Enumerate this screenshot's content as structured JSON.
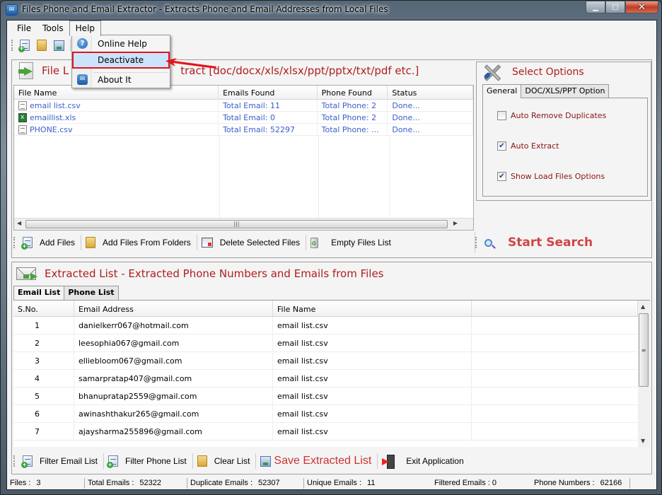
{
  "window": {
    "title": "Files Phone and Email Extractor  -  Extracts Phone and Email Addresses from Local Files",
    "controls": {
      "minimize": "▁",
      "maximize": "▢",
      "close": "✕"
    }
  },
  "menubar": {
    "items": [
      {
        "label": "File"
      },
      {
        "label": "Tools"
      },
      {
        "label": "Help"
      }
    ]
  },
  "help_menu": {
    "items": [
      {
        "label": "Online Help",
        "icon": "help-icon",
        "glyph": "?"
      },
      {
        "label": "Deactivate",
        "highlighted": true
      },
      {
        "label": "About It",
        "icon": "mail-icon",
        "glyph": "✉"
      }
    ]
  },
  "annotation": {
    "color": "#e1141c"
  },
  "file_list": {
    "title_visible_left": "File L",
    "title_visible_right": "tract  [doc/docx/xls/xlsx/ppt/pptx/txt/pdf etc.]",
    "columns": [
      "File Name",
      "Emails Found",
      "Phone Found",
      "Status"
    ],
    "rows": [
      {
        "file": "email list.csv",
        "type": "csv",
        "emails": "Total Email: 11",
        "phones": "Total Phone: 2",
        "status": "Done..."
      },
      {
        "file": "emaillist.xls",
        "type": "xls",
        "emails": "Total Email: 0",
        "phones": "Total Phone: 2",
        "status": "Done..."
      },
      {
        "file": "PHONE.csv",
        "type": "csv",
        "emails": "Total Email: 52297",
        "phones": "Total Phone: ...",
        "status": "Done..."
      }
    ],
    "buttons": {
      "add_files": "Add Files",
      "add_folders": "Add Files From Folders",
      "delete_selected": "Delete Selected Files",
      "empty_list": "Empty Files List"
    }
  },
  "options": {
    "title": "Select Options",
    "tabs": [
      "General",
      "DOC/XLS/PPT Option"
    ],
    "checkboxes": [
      {
        "label": "Auto Remove Duplicates",
        "checked": false
      },
      {
        "label": "Auto Extract",
        "checked": true
      },
      {
        "label": "Show Load Files Options",
        "checked": true
      }
    ],
    "start_search": "Start Search"
  },
  "extracted": {
    "title": "Extracted List - Extracted Phone Numbers and Emails from Files",
    "tabs": [
      "Email List",
      "Phone List"
    ],
    "columns": [
      "S.No.",
      "Email Address",
      "File Name"
    ],
    "rows": [
      {
        "sno": "1",
        "email": "danielkerr067@hotmail.com",
        "file": "email list.csv"
      },
      {
        "sno": "2",
        "email": "leesophia067@gmail.com",
        "file": "email list.csv"
      },
      {
        "sno": "3",
        "email": "elliebloom067@gmail.com",
        "file": "email list.csv"
      },
      {
        "sno": "4",
        "email": "samarpratap407@gmail.com",
        "file": "email list.csv"
      },
      {
        "sno": "5",
        "email": "bhanupratap2559@gmail.com",
        "file": "email list.csv"
      },
      {
        "sno": "6",
        "email": "awinashthakur265@gmail.com",
        "file": "email list.csv"
      },
      {
        "sno": "7",
        "email": "ajaysharma255896@gmail.com",
        "file": "email list.csv"
      }
    ],
    "buttons": {
      "filter_email": "Filter Email List",
      "filter_phone": "Filter Phone List",
      "clear_list": "Clear List",
      "save_list": "Save Extracted List",
      "exit": "Exit Application"
    }
  },
  "status": {
    "files": {
      "label": "Files :",
      "value": "3"
    },
    "total_emails": {
      "label": "Total Emails :",
      "value": "52322"
    },
    "duplicate_emails": {
      "label": "Duplicate Emails :",
      "value": "52307"
    },
    "unique_emails": {
      "label": "Unique Emails :",
      "value": "11"
    },
    "filtered_emails": {
      "label": "Filtered Emails :",
      "value": "0"
    },
    "phone_numbers": {
      "label": "Phone Numbers :",
      "value": "62166"
    }
  }
}
